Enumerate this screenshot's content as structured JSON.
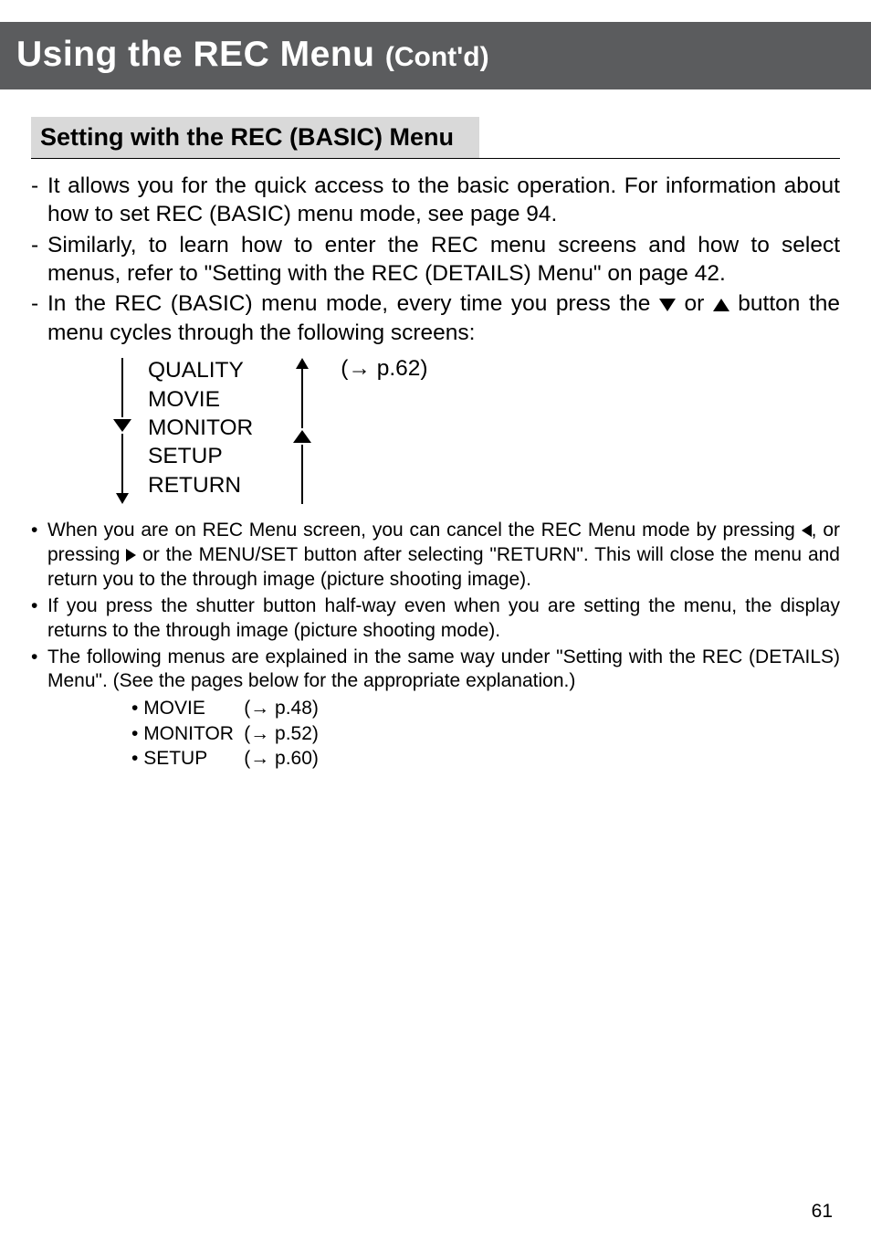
{
  "header": {
    "title_main": "Using the REC Menu ",
    "title_sub": "(Cont'd)"
  },
  "subheading": "Setting with the REC (BASIC) Menu",
  "intro_paragraphs": [
    "It allows you for the quick access to the basic operation. For information about how to set REC (BASIC) menu mode, see page 94.",
    "Similarly, to learn how to enter the REC menu screens and how to select menus, refer to \"Setting with the REC (DETAILS) Menu\" on page 42.",
    "In the REC (BASIC) menu mode, every time you press the ▼ or ▲ button the menu cycles through the following screens:"
  ],
  "menu_items": [
    "QUALITY",
    "MOVIE",
    "MONITOR",
    "SETUP",
    "RETURN"
  ],
  "quality_ref": "(→ p.62)",
  "bullets": [
    "When you are on REC Menu screen, you can cancel the REC Menu mode by pressing ◀, or pressing ▶ or the MENU/SET button after selecting \"RETURN\". This will close the menu and return you to the through image (picture shooting image).",
    "If you press the shutter button half-way even when you are setting the menu, the display returns to the through image (picture shooting mode).",
    "The following menus are explained in the same way under \"Setting with the REC (DETAILS) Menu\". (See the pages below for the appropriate explanation.)"
  ],
  "sub_bullets": [
    {
      "label": "MOVIE",
      "ref": "(→ p.48)"
    },
    {
      "label": "MONITOR",
      "ref": "(→ p.52)"
    },
    {
      "label": "SETUP",
      "ref": "(→ p.60)"
    }
  ],
  "page_number": "61",
  "chart_data": null
}
